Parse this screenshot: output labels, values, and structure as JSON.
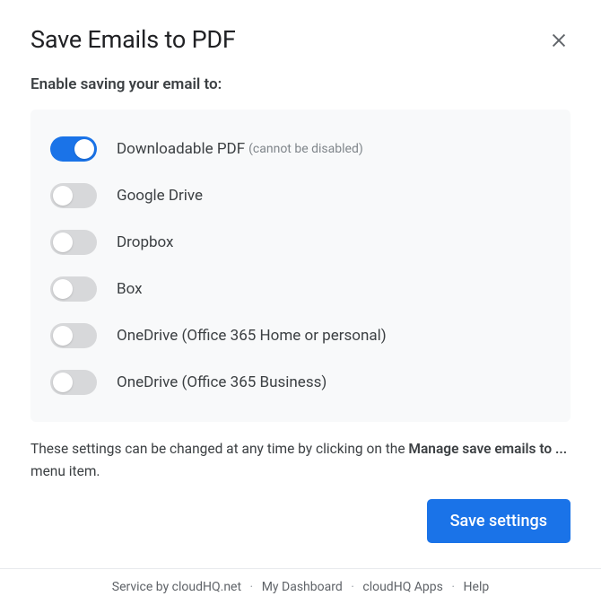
{
  "title": "Save Emails to PDF",
  "subtitle": "Enable saving your email to:",
  "options": [
    {
      "label": "Downloadable PDF",
      "note": "(cannot be disabled)",
      "enabled": true,
      "locked": true
    },
    {
      "label": "Google Drive",
      "note": "",
      "enabled": false,
      "locked": false
    },
    {
      "label": "Dropbox",
      "note": "",
      "enabled": false,
      "locked": false
    },
    {
      "label": "Box",
      "note": "",
      "enabled": false,
      "locked": false
    },
    {
      "label": "OneDrive (Office 365 Home or personal)",
      "note": "",
      "enabled": false,
      "locked": false
    },
    {
      "label": "OneDrive (Office 365 Business)",
      "note": "",
      "enabled": false,
      "locked": false
    }
  ],
  "info": {
    "pre": "These settings can be changed at any time by clicking on the ",
    "bold": "Manage save emails to ...",
    "post": " menu item."
  },
  "buttons": {
    "save": "Save settings"
  },
  "footer": {
    "service_by": "Service by ",
    "cloudhq_net": "cloudHQ.net",
    "dashboard": "My Dashboard",
    "apps": "cloudHQ Apps",
    "help": "Help"
  }
}
